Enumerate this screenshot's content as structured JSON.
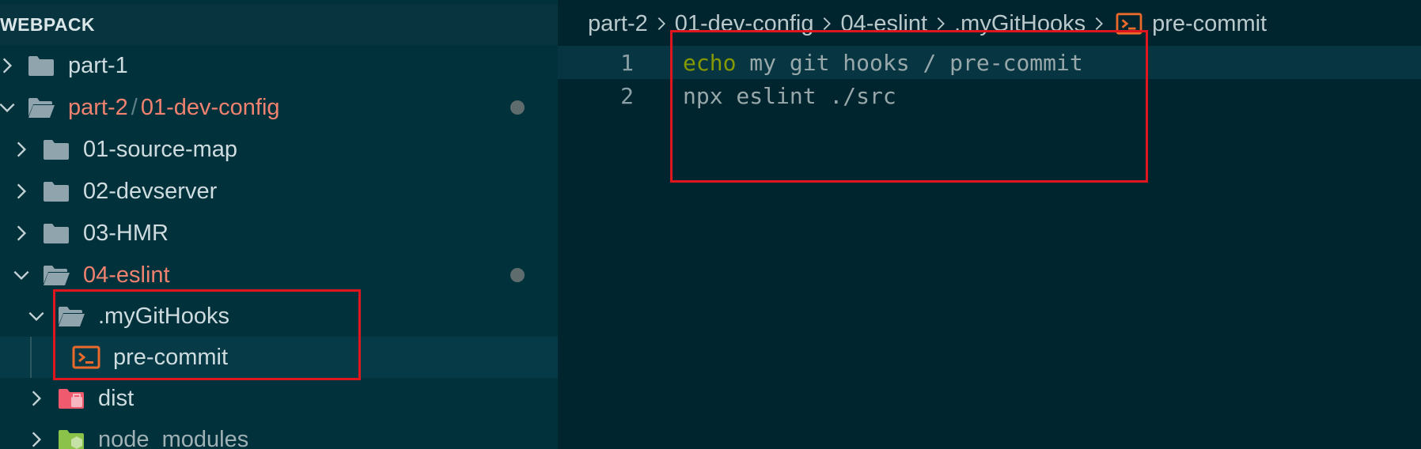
{
  "explorer": {
    "title": "WEBPACK",
    "items": [
      {
        "label": "part-1",
        "expanded": false,
        "modified": false
      },
      {
        "label_parts": [
          "part-2",
          "/",
          "01-dev-config"
        ],
        "expanded": true,
        "modified": true
      },
      {
        "label": "01-source-map",
        "expanded": false,
        "modified": false
      },
      {
        "label": "02-devserver",
        "expanded": false,
        "modified": false
      },
      {
        "label": "03-HMR",
        "expanded": false,
        "modified": false
      },
      {
        "label": "04-eslint",
        "expanded": true,
        "modified": true
      },
      {
        "label": ".myGitHooks",
        "expanded": true,
        "modified": false
      },
      {
        "label": "pre-commit",
        "selected": true,
        "type": "shell-file"
      },
      {
        "label": "dist",
        "expanded": false,
        "type": "dist-folder"
      },
      {
        "label": "node_modules",
        "expanded": false,
        "type": "node-folder"
      }
    ]
  },
  "editor": {
    "breadcrumb": [
      "part-2",
      "01-dev-config",
      "04-eslint",
      ".myGitHooks",
      "pre-commit"
    ],
    "lines": [
      {
        "number": "1",
        "keyword": "echo",
        "rest": " my git hooks / pre-commit"
      },
      {
        "number": "2",
        "keyword": "",
        "rest": "npx eslint ./src"
      }
    ]
  },
  "icons": {
    "folder": "folder-icon",
    "folder_open": "folder-open-icon",
    "shell": "terminal-file-icon",
    "dist": "dist-folder-icon",
    "node": "node-modules-folder-icon",
    "chevron_right": "chevron-right-icon",
    "chevron_down": "chevron-down-icon"
  },
  "colors": {
    "background": "#00252f",
    "sidebar": "#01313b",
    "modified_text": "#f0826f",
    "keyword": "#859900",
    "annotation": "#e0161f",
    "shell_icon": "#e96a2b"
  }
}
